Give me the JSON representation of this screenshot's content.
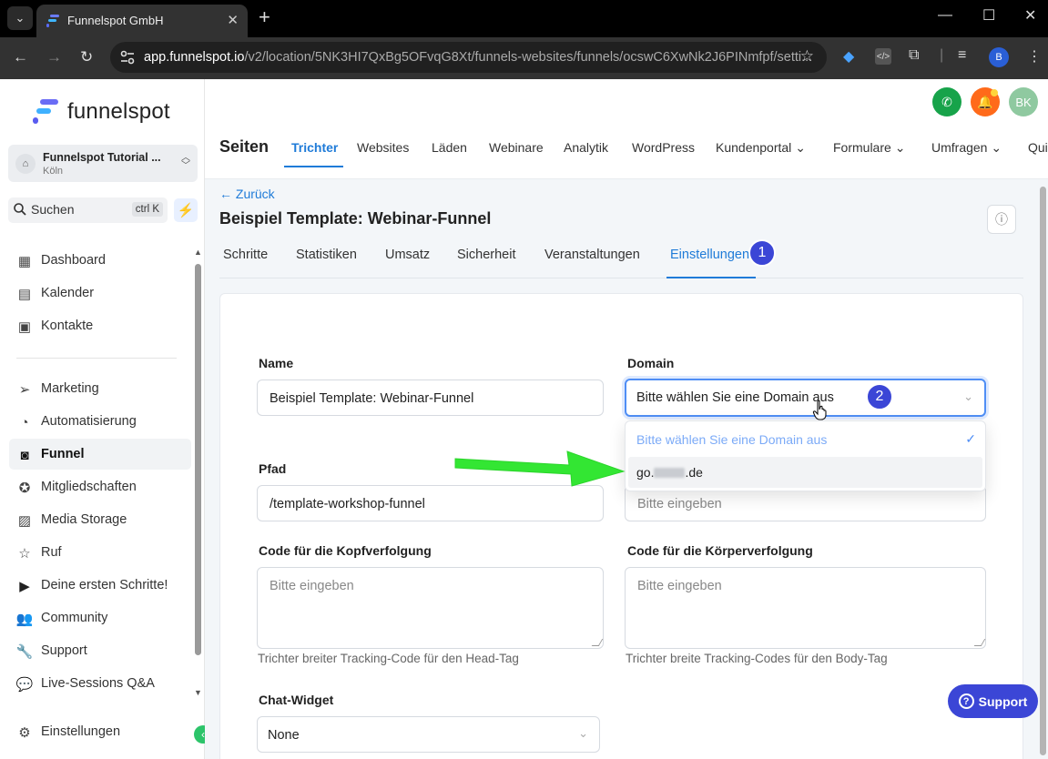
{
  "browser": {
    "tab_title": "Funnelspot GmbH",
    "new_tab": "+",
    "url_host": "app.funnelspot.io",
    "url_path": "/v2/location/5NK3HI7QxBg5OFvqG8Xt/funnels-websites/funnels/ocswC6XwNk2J6PINmfpf/setti...",
    "profile_initial": "B"
  },
  "sidebar": {
    "logo_text": "funnelspot",
    "location": {
      "name": "Funnelspot Tutorial ...",
      "city": "Köln"
    },
    "search": {
      "label": "Suchen",
      "shortcut": "ctrl K"
    },
    "items_top": [
      {
        "label": "Dashboard"
      },
      {
        "label": "Kalender"
      },
      {
        "label": "Kontakte"
      }
    ],
    "items_main": [
      {
        "label": "Marketing"
      },
      {
        "label": "Automatisierung"
      },
      {
        "label": "Funnel"
      },
      {
        "label": "Mitgliedschaften"
      },
      {
        "label": "Media Storage"
      },
      {
        "label": "Ruf"
      },
      {
        "label": "Deine ersten Schritte!"
      },
      {
        "label": "Community"
      },
      {
        "label": "Support"
      },
      {
        "label": "Live-Sessions Q&A"
      }
    ],
    "settings_label": "Einstellungen"
  },
  "header": {
    "user_initials": "BK",
    "section_title": "Seiten",
    "nav": [
      {
        "label": "Trichter"
      },
      {
        "label": "Websites"
      },
      {
        "label": "Läden"
      },
      {
        "label": "Webinare"
      },
      {
        "label": "Analytik"
      },
      {
        "label": "WordPress"
      },
      {
        "label": "Kundenportal"
      },
      {
        "label": "Formulare"
      },
      {
        "label": "Umfragen"
      },
      {
        "label": "Qui"
      }
    ]
  },
  "page": {
    "back_label": "← Zurück",
    "title": "Beispiel Template: Webinar-Funnel",
    "subtabs": [
      {
        "label": "Schritte"
      },
      {
        "label": "Statistiken"
      },
      {
        "label": "Umsatz"
      },
      {
        "label": "Sicherheit"
      },
      {
        "label": "Veranstaltungen"
      },
      {
        "label": "Einstellungen"
      }
    ],
    "form": {
      "name_label": "Name",
      "name_value": "Beispiel Template: Webinar-Funnel",
      "domain_label": "Domain",
      "domain_value": "Bitte wählen Sie eine Domain aus",
      "domain_options": [
        {
          "label": "Bitte wählen Sie eine Domain aus"
        },
        {
          "prefix": "go.",
          "suffix": ".de"
        }
      ],
      "path_label": "Pfad",
      "path_value": "/template-workshop-funnel",
      "right2_placeholder": "Bitte eingeben",
      "head_label": "Code für die Kopfverfolgung",
      "head_placeholder": "Bitte eingeben",
      "head_hint": "Trichter breiter Tracking-Code für den Head-Tag",
      "body_label": "Code für die Körperverfolgung",
      "body_placeholder": "Bitte eingeben",
      "body_hint": "Trichter breite Tracking-Codes für den Body-Tag",
      "chat_label": "Chat-Widget",
      "chat_value": "None"
    }
  },
  "annotations": {
    "step1": "1",
    "step2": "2"
  },
  "support_button": "Support",
  "colors": {
    "accent": "#1f7bd8",
    "badge": "#3b46d6",
    "arrow": "#33e633",
    "call": "#17a34a",
    "bell": "#ff6a1a",
    "avatar": "#8fc9a0"
  }
}
